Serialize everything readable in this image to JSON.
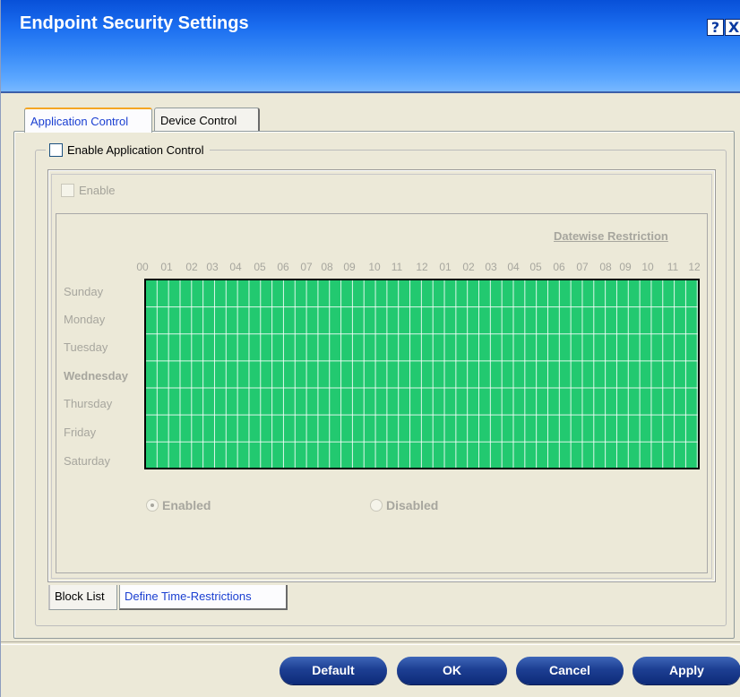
{
  "window": {
    "title": "Endpoint Security Settings",
    "help_glyph": "?",
    "close_glyph": "X"
  },
  "top_tabs": [
    {
      "label": "Application Control",
      "selected": true
    },
    {
      "label": "Device Control",
      "selected": false
    }
  ],
  "app_control": {
    "enable_label": "Enable Application Control",
    "enable_checked": false,
    "inner_enable_label": "Enable",
    "inner_enable_checked": false,
    "datewise_link": "Datewise Restriction",
    "hours": [
      "00",
      "01",
      "02",
      "03",
      "04",
      "05",
      "06",
      "07",
      "08",
      "09",
      "10",
      "11",
      "12",
      "01",
      "02",
      "03",
      "04",
      "05",
      "06",
      "07",
      "08",
      "09",
      "10",
      "11",
      "12"
    ],
    "days": [
      "Sunday",
      "Monday",
      "Tuesday",
      "Wednesday",
      "Thursday",
      "Friday",
      "Saturday"
    ],
    "highlighted_day": "Wednesday",
    "grid_color": "#22c970",
    "mode_options": [
      {
        "label": "Enabled",
        "selected": true
      },
      {
        "label": "Disabled",
        "selected": false
      }
    ]
  },
  "bottom_tabs": [
    {
      "label": "Block List",
      "selected": false
    },
    {
      "label": "Define Time-Restrictions",
      "selected": true
    }
  ],
  "buttons": {
    "default": "Default",
    "ok": "OK",
    "cancel": "Cancel",
    "apply": "Apply"
  },
  "colors": {
    "title_bar": "#1b6ef0",
    "accent_tab_text": "#1a3fd1",
    "button_fill": "#1d3f93",
    "disabled_text": "#a7a69e"
  }
}
